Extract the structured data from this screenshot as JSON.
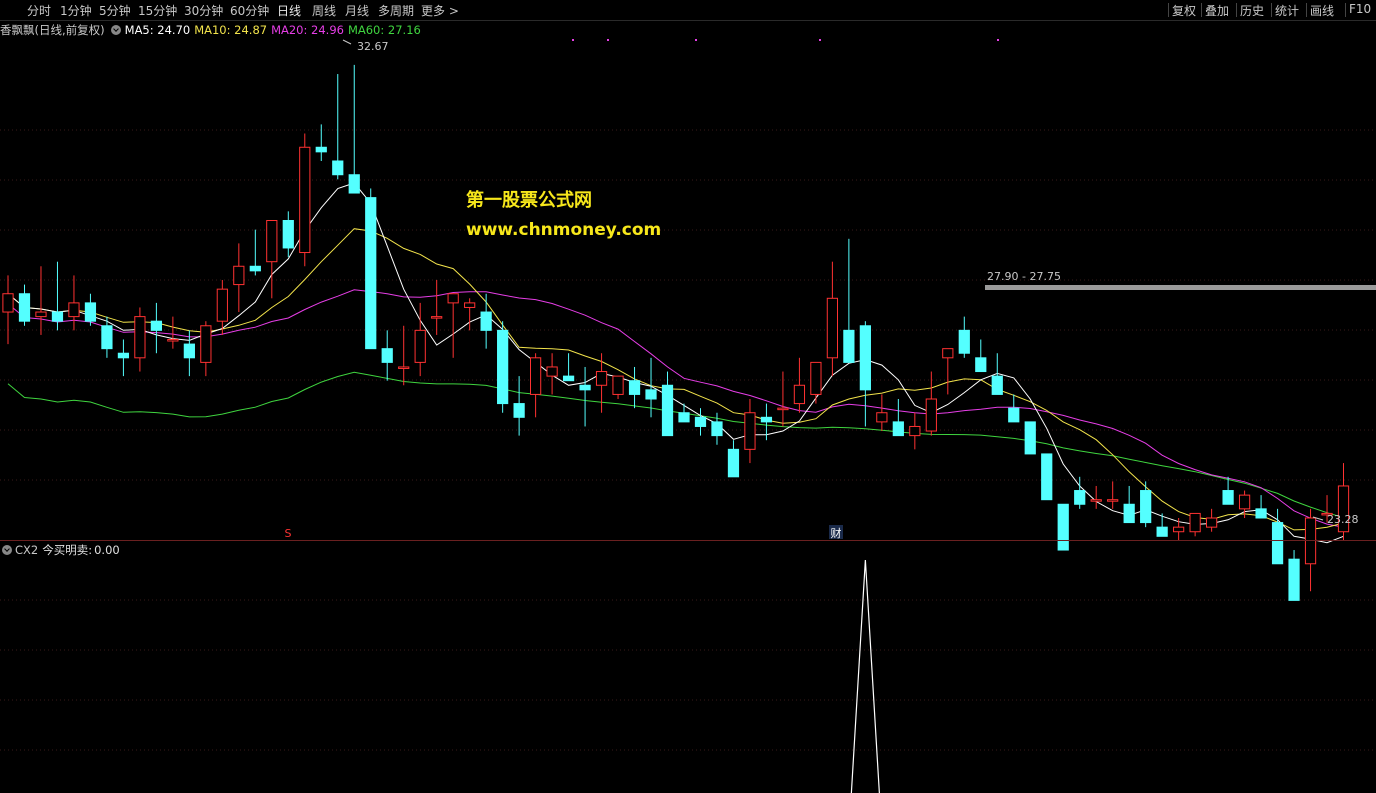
{
  "toolbar": {
    "tabs": [
      "分时",
      "1分钟",
      "5分钟",
      "15分钟",
      "30分钟",
      "60分钟",
      "日线",
      "周线",
      "月线",
      "多周期",
      "更多 >"
    ],
    "active_tab": "日线",
    "right_buttons": [
      "复权",
      "叠加",
      "历史",
      "统计",
      "画线",
      "F10"
    ]
  },
  "main": {
    "stock_title": "香飘飘(日线,前复权)",
    "ma": [
      {
        "label": "MA5:",
        "value": "24.70",
        "color": "#ffffff"
      },
      {
        "label": "MA10:",
        "value": "24.87",
        "color": "#f2e34b"
      },
      {
        "label": "MA20:",
        "value": "24.96",
        "color": "#e63ee6"
      },
      {
        "label": "MA60:",
        "value": "27.16",
        "color": "#3fd43f"
      }
    ],
    "high_label": "32.67",
    "low_label": "23.28",
    "range_label": "27.90 - 27.75",
    "marker_s": "S",
    "marker_cai": "财",
    "watermark_cn": "第一股票公式网",
    "watermark_url": "www.chnmoney.com"
  },
  "sub": {
    "indicator": "CX2",
    "series_label": "今买明卖:",
    "series_value": "0.00"
  },
  "colors": {
    "up": "#ff3232",
    "down": "#54ffff",
    "ma5": "#ffffff",
    "ma10": "#f2e34b",
    "ma20": "#e63ee6",
    "ma60": "#3fd43f",
    "grid": "#3a1a1a"
  },
  "chart_data": {
    "type": "candlestick",
    "price_range": [
      22.8,
      33.2
    ],
    "candles": [
      [
        27.3,
        28.1,
        26.6,
        27.7
      ],
      [
        27.7,
        27.9,
        27.0,
        27.1
      ],
      [
        27.2,
        28.3,
        26.8,
        27.3
      ],
      [
        27.3,
        28.4,
        26.9,
        27.1
      ],
      [
        27.2,
        28.1,
        26.9,
        27.5
      ],
      [
        27.5,
        27.7,
        27.0,
        27.1
      ],
      [
        27.0,
        27.2,
        26.3,
        26.5
      ],
      [
        26.4,
        26.7,
        25.9,
        26.3
      ],
      [
        26.3,
        27.4,
        26.0,
        27.2
      ],
      [
        27.1,
        27.5,
        26.4,
        26.9
      ],
      [
        26.7,
        27.2,
        26.5,
        26.7
      ],
      [
        26.6,
        26.9,
        25.9,
        26.3
      ],
      [
        26.2,
        27.1,
        25.9,
        27.0
      ],
      [
        27.1,
        28.0,
        26.8,
        27.8
      ],
      [
        27.9,
        28.8,
        27.3,
        28.3
      ],
      [
        28.3,
        29.1,
        28.1,
        28.2
      ],
      [
        28.4,
        28.9,
        27.6,
        29.3
      ],
      [
        29.3,
        29.5,
        28.5,
        28.7
      ],
      [
        28.6,
        31.2,
        28.3,
        30.9
      ],
      [
        30.9,
        31.4,
        30.6,
        30.8
      ],
      [
        30.6,
        32.5,
        30.2,
        30.3
      ],
      [
        30.3,
        32.7,
        30.0,
        29.9
      ],
      [
        29.8,
        30.0,
        28.2,
        26.5
      ],
      [
        26.5,
        26.9,
        25.8,
        26.2
      ],
      [
        26.1,
        27.0,
        25.7,
        26.1
      ],
      [
        26.2,
        27.5,
        25.9,
        26.9
      ],
      [
        27.2,
        28.0,
        26.8,
        27.2
      ],
      [
        27.5,
        27.7,
        26.3,
        27.7
      ],
      [
        27.4,
        27.6,
        26.9,
        27.5
      ],
      [
        27.3,
        27.7,
        26.5,
        26.9
      ],
      [
        26.9,
        27.1,
        25.1,
        25.3
      ],
      [
        25.3,
        25.9,
        24.6,
        25.0
      ],
      [
        25.5,
        26.4,
        25.0,
        26.3
      ],
      [
        25.9,
        26.4,
        25.5,
        26.1
      ],
      [
        25.9,
        26.4,
        25.9,
        25.8
      ],
      [
        25.7,
        26.1,
        24.8,
        25.6
      ],
      [
        25.7,
        26.4,
        25.1,
        26.0
      ],
      [
        25.5,
        25.8,
        25.4,
        25.9
      ],
      [
        25.8,
        26.1,
        25.2,
        25.5
      ],
      [
        25.6,
        26.3,
        25.0,
        25.4
      ],
      [
        25.7,
        26.0,
        25.6,
        24.6
      ],
      [
        25.1,
        25.3,
        24.9,
        24.9
      ],
      [
        25.0,
        25.2,
        24.6,
        24.8
      ],
      [
        24.9,
        25.1,
        24.4,
        24.6
      ],
      [
        24.3,
        24.5,
        23.9,
        23.7
      ],
      [
        24.3,
        25.4,
        24.0,
        25.1
      ],
      [
        25.0,
        25.3,
        24.5,
        24.9
      ],
      [
        25.2,
        26.0,
        24.8,
        25.2
      ],
      [
        25.3,
        26.3,
        25.1,
        25.7
      ],
      [
        25.5,
        26.2,
        25.3,
        26.2
      ],
      [
        26.3,
        28.4,
        25.9,
        27.6
      ],
      [
        26.9,
        28.9,
        26.8,
        26.2
      ],
      [
        27.0,
        27.1,
        24.8,
        25.6
      ],
      [
        24.9,
        25.5,
        24.7,
        25.1
      ],
      [
        24.9,
        25.4,
        24.6,
        24.6
      ],
      [
        24.6,
        25.1,
        24.3,
        24.8
      ],
      [
        24.7,
        26.0,
        24.6,
        25.4
      ],
      [
        26.3,
        26.5,
        25.5,
        26.5
      ],
      [
        26.9,
        27.2,
        26.3,
        26.4
      ],
      [
        26.3,
        26.7,
        26.0,
        26.0
      ],
      [
        25.9,
        26.4,
        25.6,
        25.5
      ],
      [
        25.2,
        25.5,
        24.9,
        24.9
      ],
      [
        24.9,
        24.9,
        24.3,
        24.2
      ],
      [
        24.2,
        24.2,
        23.7,
        23.2
      ],
      [
        23.1,
        23.1,
        22.8,
        22.1
      ],
      [
        23.4,
        23.7,
        23.0,
        23.1
      ],
      [
        23.2,
        23.5,
        23.0,
        23.2
      ],
      [
        23.2,
        23.6,
        23.0,
        23.2
      ],
      [
        23.1,
        23.5,
        22.8,
        22.7
      ],
      [
        23.4,
        23.6,
        22.6,
        22.7
      ],
      [
        22.6,
        22.9,
        22.4,
        22.4
      ],
      [
        22.5,
        22.8,
        22.3,
        22.6
      ],
      [
        22.5,
        22.9,
        22.4,
        22.9
      ],
      [
        22.6,
        23.0,
        22.5,
        22.8
      ],
      [
        23.4,
        23.7,
        23.1,
        23.1
      ],
      [
        23.0,
        23.4,
        22.8,
        23.3
      ],
      [
        23.0,
        23.3,
        22.9,
        22.8
      ],
      [
        22.7,
        23.0,
        22.5,
        21.8
      ],
      [
        21.9,
        22.1,
        21.0,
        21.0
      ],
      [
        21.8,
        23.0,
        21.2,
        22.8
      ],
      [
        22.9,
        23.3,
        22.7,
        22.9
      ],
      [
        22.5,
        24.0,
        22.3,
        23.5
      ]
    ],
    "sub_signal_peak_index": 52,
    "sub_signal_value": 1
  }
}
